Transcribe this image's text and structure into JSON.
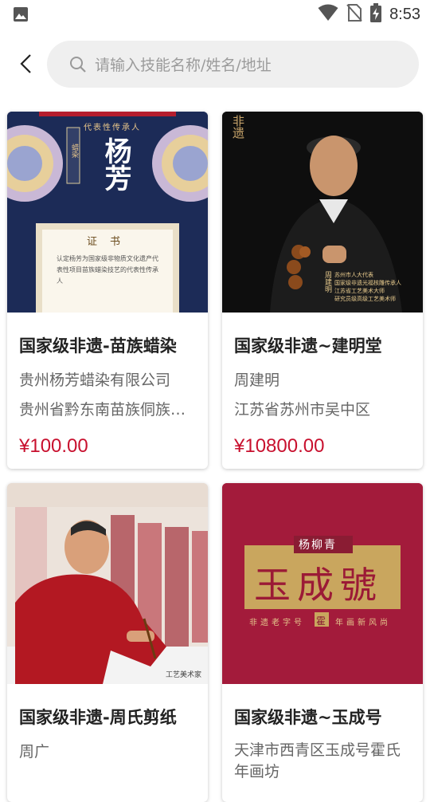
{
  "status_bar": {
    "time": "8:53"
  },
  "search": {
    "placeholder": "请输入技能名称/姓名/地址"
  },
  "cards": [
    {
      "title": "国家级非遗-苗族蜡染",
      "line1": "贵州杨芳蜡染有限公司",
      "line2": "贵州省黔东南苗族侗族自治州",
      "price": "¥100.00",
      "image": {
        "banner": "代表性传承人",
        "name": "杨芳",
        "seal": "蜡染",
        "cert_title": "证书",
        "cert_text": "认定杨芳为国家级非物质文化遗产代表性项目苗族蜡染技艺的代表性传承人"
      }
    },
    {
      "title": "国家级非遗~建明堂",
      "line1": "周建明",
      "line2": "江苏省苏州市吴中区",
      "price": "¥10800.00",
      "image": {
        "logo": "非遗",
        "name": "周建明",
        "caption_lines": [
          "苏州市人大代表",
          "国家级非遗光福核雕传承人",
          "江苏省工艺美术大师",
          "研究员级高级工艺美术师"
        ]
      }
    },
    {
      "title": "国家级非遗-周氏剪纸",
      "line1": "周广",
      "line2": "",
      "price": "",
      "image": {
        "caption": "工艺美术家"
      }
    },
    {
      "title": "国家级非遗~玉成号",
      "line1": "天津市西青区玉成号霍氏年画坊",
      "line2": "",
      "price": "",
      "image": {
        "top_label": "杨柳青",
        "brand": "玉成號",
        "tagline_left": "非遗老字号",
        "seal": "霍",
        "tagline_right": "年画新风尚"
      }
    }
  ],
  "colors": {
    "price": "#c8102e",
    "search_bg": "#efefef",
    "card3_bg": "#a31b3b",
    "card1_bg": "#1c2b57"
  }
}
